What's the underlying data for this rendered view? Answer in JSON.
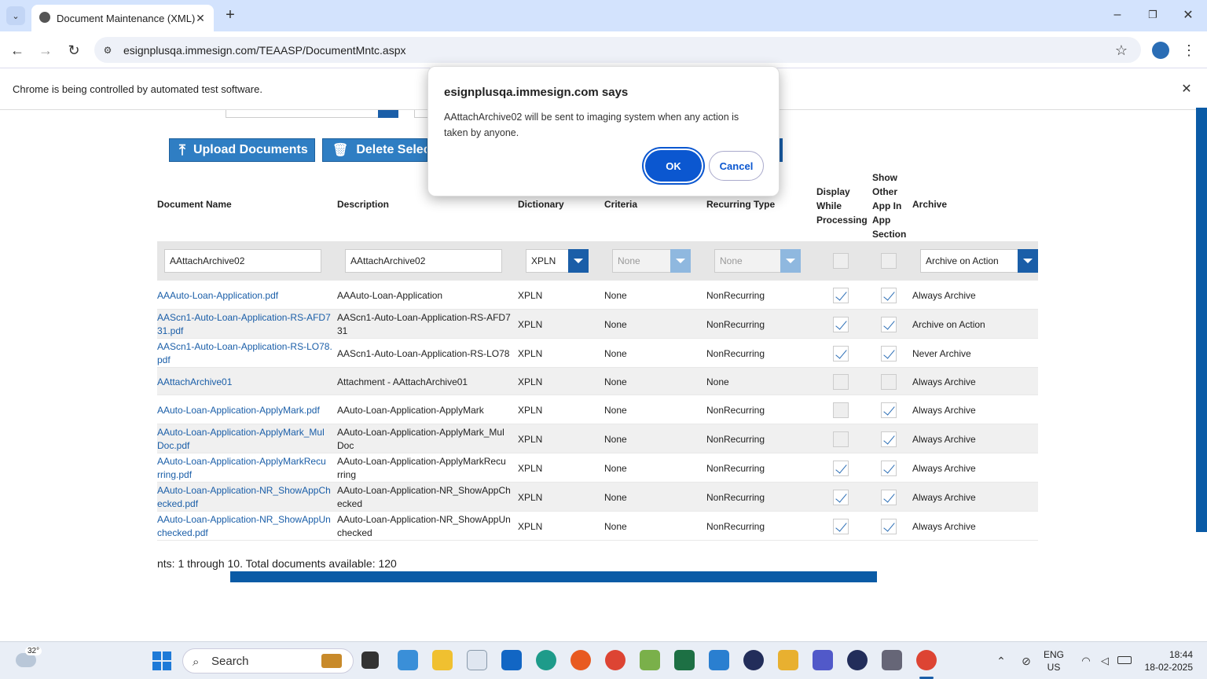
{
  "browser": {
    "tab_title": "Document Maintenance (XML)",
    "url": "esignplusqa.immesign.com/TEAASP/DocumentMntc.aspx",
    "infobar_text": "Chrome is being controlled by automated test software."
  },
  "toolbar": {
    "upload_label": "Upload Documents",
    "delete_label": "Delete Select"
  },
  "table": {
    "headers": {
      "doc_name": "Document Name",
      "description": "Description",
      "dictionary": "Dictionary",
      "criteria": "Criteria",
      "recurring": "Recurring Type",
      "display_l1": "Display",
      "display_l2": "While",
      "display_l3": "Processing",
      "show_l1": "Show",
      "show_l2": "Other",
      "show_l3": "App In",
      "show_l4": "App",
      "show_l5": "Section",
      "archive": "Archive"
    },
    "filter": {
      "doc_name": "AAttachArchive02",
      "description": "AAttachArchive02",
      "dictionary": "XPLN",
      "criteria": "None",
      "recurring": "None",
      "archive": "Archive on Action"
    },
    "rows": [
      {
        "n1": "AAAuto-Loan-Application.pdf",
        "n2": "",
        "d1": "AAAuto-Loan-Application",
        "d2": "",
        "dict": "XPLN",
        "crit": "None",
        "rec": "NonRecurring",
        "disp": true,
        "show": true,
        "arch": "Always Archive"
      },
      {
        "n1": "AAScn1-Auto-Loan-Application-RS-AFD7",
        "n2": "31.pdf",
        "d1": "AAScn1-Auto-Loan-Application-RS-AFD7",
        "d2": "31",
        "dict": "XPLN",
        "crit": "None",
        "rec": "NonRecurring",
        "disp": true,
        "show": true,
        "arch": "Archive on Action"
      },
      {
        "n1": "AAScn1-Auto-Loan-Application-RS-LO78.",
        "n2": "pdf",
        "d1": "AAScn1-Auto-Loan-Application-RS-LO78",
        "d2": "",
        "dict": "XPLN",
        "crit": "None",
        "rec": "NonRecurring",
        "disp": true,
        "show": true,
        "arch": "Never Archive"
      },
      {
        "n1": "AAttachArchive01",
        "n2": "",
        "d1": "Attachment - AAttachArchive01",
        "d2": "",
        "dict": "XPLN",
        "crit": "None",
        "rec": "None",
        "disp": false,
        "show": false,
        "arch": "Always Archive"
      },
      {
        "n1": "AAuto-Loan-Application-ApplyMark.pdf",
        "n2": "",
        "d1": "AAuto-Loan-Application-ApplyMark",
        "d2": "",
        "dict": "XPLN",
        "crit": "None",
        "rec": "NonRecurring",
        "disp": false,
        "show": true,
        "arch": "Always Archive"
      },
      {
        "n1": "AAuto-Loan-Application-ApplyMark_Mul",
        "n2": "Doc.pdf",
        "d1": "AAuto-Loan-Application-ApplyMark_Mul",
        "d2": "Doc",
        "dict": "XPLN",
        "crit": "None",
        "rec": "NonRecurring",
        "disp": false,
        "show": true,
        "arch": "Always Archive"
      },
      {
        "n1": "AAuto-Loan-Application-ApplyMarkRecu",
        "n2": "rring.pdf",
        "d1": "AAuto-Loan-Application-ApplyMarkRecu",
        "d2": "rring",
        "dict": "XPLN",
        "crit": "None",
        "rec": "NonRecurring",
        "disp": true,
        "show": true,
        "arch": "Always Archive"
      },
      {
        "n1": "AAuto-Loan-Application-NR_ShowAppCh",
        "n2": "ecked.pdf",
        "d1": "AAuto-Loan-Application-NR_ShowAppCh",
        "d2": "ecked",
        "dict": "XPLN",
        "crit": "None",
        "rec": "NonRecurring",
        "disp": true,
        "show": true,
        "arch": "Always Archive"
      },
      {
        "n1": "AAuto-Loan-Application-NR_ShowAppUn",
        "n2": "checked.pdf",
        "d1": "AAuto-Loan-Application-NR_ShowAppUn",
        "d2": "checked",
        "dict": "XPLN",
        "crit": "None",
        "rec": "NonRecurring",
        "disp": true,
        "show": true,
        "arch": "Always Archive"
      }
    ]
  },
  "pager_text": "nts: 1 through 10. Total documents available: 120",
  "dialog": {
    "title": "esignplusqa.immesign.com says",
    "message": "AAttachArchive02 will be sent to imaging system when any action is taken by anyone.",
    "ok_label": "OK",
    "cancel_label": "Cancel"
  },
  "taskbar": {
    "weather": "32°",
    "search_label": "Search",
    "lang1": "ENG",
    "lang2": "US",
    "time": "18:44",
    "date": "18-02-2025"
  }
}
